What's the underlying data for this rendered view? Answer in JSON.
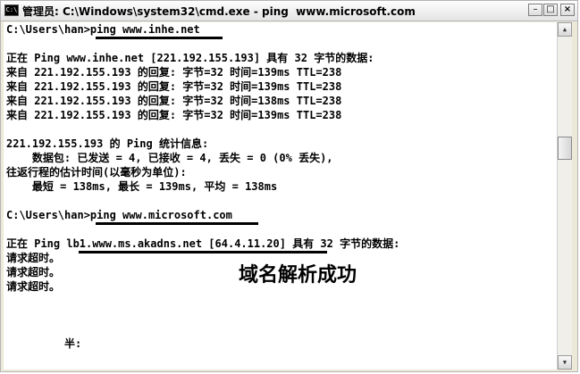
{
  "window": {
    "title": "管理员: C:\\Windows\\system32\\cmd.exe - ping  www.microsoft.com",
    "icon_label": "C:\\",
    "minimize_label": "–",
    "maximize_label": "□",
    "close_label": "×",
    "scroll_up_label": "▲",
    "scroll_down_label": "▼"
  },
  "console": {
    "lines": [
      "C:\\Users\\han>ping www.inhe.net",
      "",
      "正在 Ping www.inhe.net [221.192.155.193] 具有 32 字节的数据:",
      "来自 221.192.155.193 的回复: 字节=32 时间=139ms TTL=238",
      "来自 221.192.155.193 的回复: 字节=32 时间=139ms TTL=238",
      "来自 221.192.155.193 的回复: 字节=32 时间=138ms TTL=238",
      "来自 221.192.155.193 的回复: 字节=32 时间=139ms TTL=238",
      "",
      "221.192.155.193 的 Ping 统计信息:",
      "    数据包: 已发送 = 4, 已接收 = 4, 丢失 = 0 (0% 丢失),",
      "往返行程的估计时间(以毫秒为单位):",
      "    最短 = 138ms, 最长 = 139ms, 平均 = 138ms",
      "",
      "C:\\Users\\han>ping www.microsoft.com",
      "",
      "正在 Ping lb1.www.ms.akadns.net [64.4.11.20] 具有 32 字节的数据:",
      "请求超时。",
      "请求超时。",
      "请求超时。",
      "",
      "",
      "",
      "         半:"
    ]
  },
  "annotation": {
    "text": "域名解析成功"
  }
}
